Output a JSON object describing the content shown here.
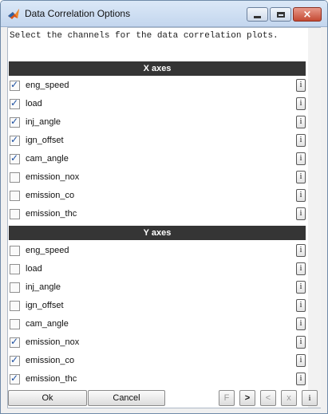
{
  "window": {
    "title": "Data Correlation Options",
    "controls": {
      "minimize": "minimize-icon",
      "maximize": "maximize-icon",
      "close": "×"
    }
  },
  "instructions": "Select the channels for the data correlation plots.",
  "x_axes": {
    "header": "X axes",
    "items": [
      {
        "label": "eng_speed",
        "checked": true,
        "info": "i"
      },
      {
        "label": "load",
        "checked": true,
        "info": "i"
      },
      {
        "label": "inj_angle",
        "checked": true,
        "info": "i"
      },
      {
        "label": "ign_offset",
        "checked": true,
        "info": "i"
      },
      {
        "label": "cam_angle",
        "checked": true,
        "info": "i"
      },
      {
        "label": "emission_nox",
        "checked": false,
        "info": "i"
      },
      {
        "label": "emission_co",
        "checked": false,
        "info": "i"
      },
      {
        "label": "emission_thc",
        "checked": false,
        "info": "i"
      }
    ]
  },
  "y_axes": {
    "header": "Y axes",
    "items": [
      {
        "label": "eng_speed",
        "checked": false,
        "info": "i"
      },
      {
        "label": "load",
        "checked": false,
        "info": "i"
      },
      {
        "label": "inj_angle",
        "checked": false,
        "info": "i"
      },
      {
        "label": "ign_offset",
        "checked": false,
        "info": "i"
      },
      {
        "label": "cam_angle",
        "checked": false,
        "info": "i"
      },
      {
        "label": "emission_nox",
        "checked": true,
        "info": "i"
      },
      {
        "label": "emission_co",
        "checked": true,
        "info": "i"
      },
      {
        "label": "emission_thc",
        "checked": true,
        "info": "i"
      }
    ]
  },
  "buttons": {
    "ok": "Ok",
    "cancel": "Cancel",
    "first": "F",
    "next": ">",
    "prev": "<",
    "clear": "x",
    "info": "i"
  }
}
